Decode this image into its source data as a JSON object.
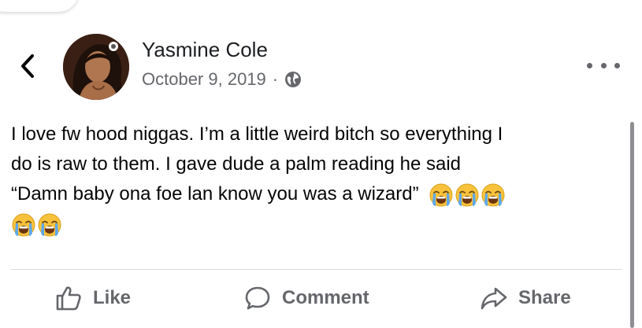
{
  "post": {
    "author": "Yasmine Cole",
    "date": "October 9, 2019",
    "separator": "·",
    "privacy_icon": "globe-icon",
    "text_lines": [
      "I love fw hood niggas. I’m a little weird bitch so everything I",
      "do is raw to them. I gave dude a palm reading he said",
      "“Damn baby ona foe lan know you was a wizard”"
    ],
    "emoji": "loudly-crying-face",
    "emoji_count_line3": 3,
    "emoji_count_line4": 2
  },
  "nav": {
    "back_icon": "chevron-left-icon",
    "more_icon": "more-horizontal-icon"
  },
  "actions": {
    "like_label": "Like",
    "comment_label": "Comment",
    "share_label": "Share"
  },
  "colors": {
    "text": "#050505",
    "secondary": "#65676b",
    "divider": "#dadde1",
    "emoji_face": "#f9c23c",
    "emoji_tears": "#5fa8e8"
  }
}
